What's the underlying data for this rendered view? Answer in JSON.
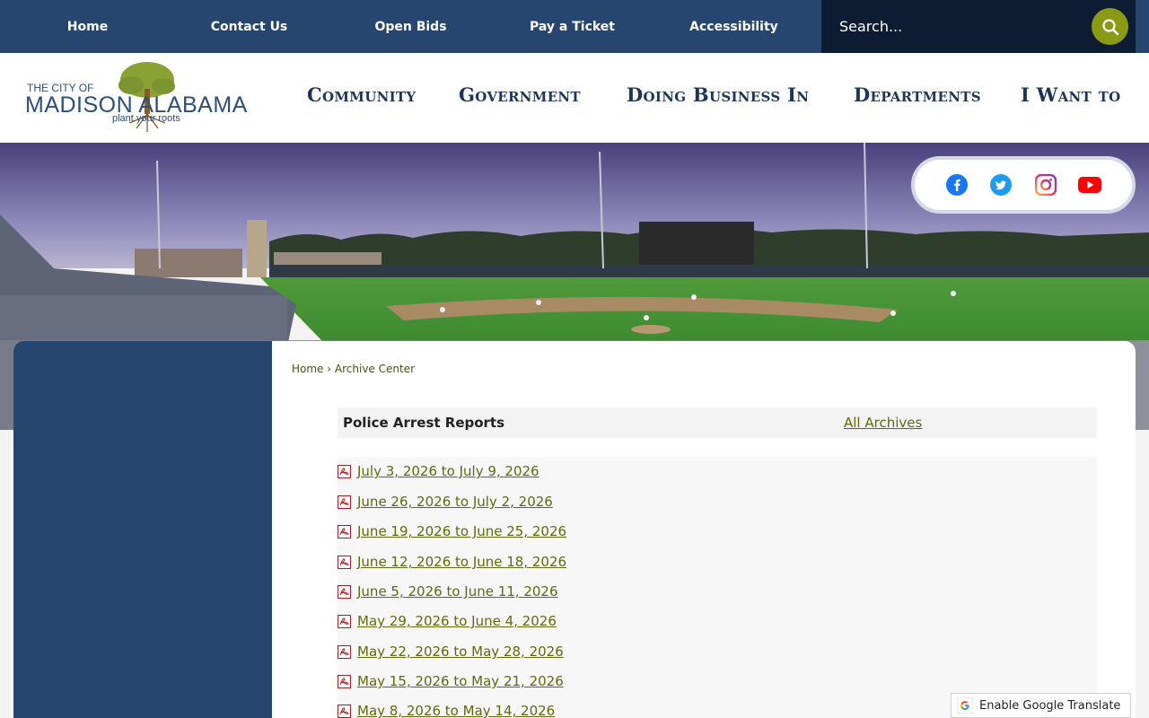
{
  "topnav": {
    "items": [
      "Home",
      "Contact Us",
      "Open Bids",
      "Pay a Ticket",
      "Accessibility"
    ]
  },
  "search": {
    "placeholder": "Search..."
  },
  "logo": {
    "line1": "THE CITY OF",
    "line2": "MADISON ALABAMA",
    "tagline": "plant your roots"
  },
  "mainnav": {
    "items": [
      "Community",
      "Government",
      "Doing Business In",
      "Departments",
      "I Want to"
    ]
  },
  "social": {
    "icons": [
      "facebook-icon",
      "twitter-icon",
      "instagram-icon",
      "youtube-icon"
    ]
  },
  "breadcrumb": {
    "home": "Home",
    "separator": "›",
    "current": "Archive Center"
  },
  "archive": {
    "title": "Police Arrest Reports",
    "all_archives": "All Archives",
    "items": [
      "July 3, 2026 to July 9, 2026",
      "June 26, 2026 to July 2, 2026",
      "June 19, 2026 to June 25, 2026",
      "June 12, 2026 to June 18, 2026",
      "June 5, 2026 to June 11, 2026",
      "May 29, 2026 to June 4, 2026",
      "May 22, 2026 to May 28, 2026",
      "May 15, 2026 to May 21, 2026",
      "May 8, 2026 to May 14, 2026"
    ]
  },
  "translate": {
    "label": "Enable Google Translate"
  },
  "colors": {
    "navy": "#27466f",
    "search_bg": "#0e1c33",
    "accent_green": "#8a9a14",
    "link_olive": "#5f6a0c"
  }
}
